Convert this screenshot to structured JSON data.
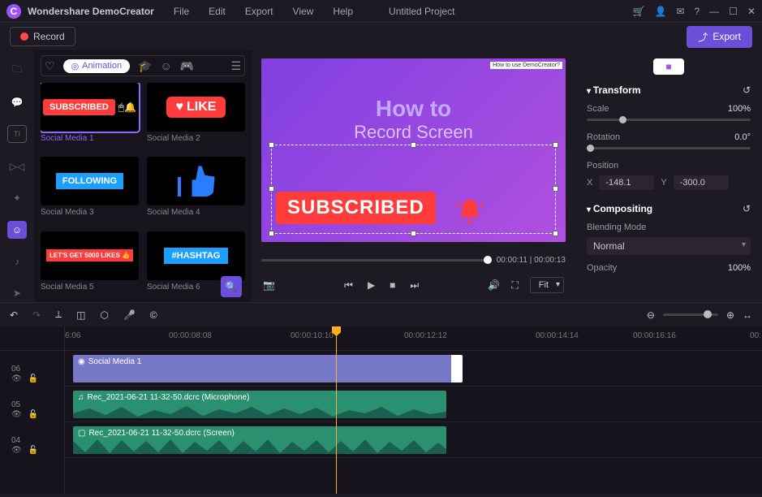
{
  "titlebar": {
    "app_name": "Wondershare DemoCreator",
    "menus": [
      "File",
      "Edit",
      "Export",
      "View",
      "Help"
    ],
    "project_name": "Untitled Project"
  },
  "toolbar": {
    "record_label": "Record",
    "export_label": "Export"
  },
  "asset": {
    "animation_tab": "Animation",
    "items": [
      {
        "label": "Social Media 1"
      },
      {
        "label": "Social Media 2"
      },
      {
        "label": "Social Media 3"
      },
      {
        "label": "Social Media 4"
      },
      {
        "label": "Social Media 5"
      },
      {
        "label": "Social Media 6"
      }
    ],
    "thumb_text": {
      "subscribed": "SUBSCRIBED",
      "like": "LIKE",
      "following": "FOLLOWING",
      "lets": "LET'S GET 5000 LIKES 👍",
      "hashtag": "#HASHTAG"
    }
  },
  "preview": {
    "title_line1": "How to",
    "title_line2": "Record Screen",
    "overlay_text": "SUBSCRIBED",
    "mini_badge": "How to use DemoCreator?",
    "time": "00:00:11 | 00:00:13",
    "fit_label": "Fit"
  },
  "props": {
    "transform_head": "Transform",
    "scale_label": "Scale",
    "scale_val": "100%",
    "rotation_label": "Rotation",
    "rotation_val": "0.0°",
    "position_label": "Position",
    "x_label": "X",
    "x_val": "-148.1",
    "y_label": "Y",
    "y_val": "-300.0",
    "compositing_head": "Compositing",
    "blend_label": "Blending Mode",
    "blend_val": "Normal",
    "opacity_label": "Opacity",
    "opacity_val": "100%"
  },
  "timeline": {
    "ruler": [
      "6:06",
      "00:00:08:08",
      "00:00:10:10",
      "00:00:12:12",
      "00:00:14:14",
      "00:00:16:16",
      "00:"
    ],
    "tracks": {
      "t06": "06",
      "t05": "05",
      "t04": "04"
    },
    "clips": {
      "video": "Social Media 1",
      "audio": "Rec_2021-06-21 11-32-50.dcrc (Microphone)",
      "screen": "Rec_2021-06-21 11-32-50.dcrc (Screen)"
    }
  }
}
